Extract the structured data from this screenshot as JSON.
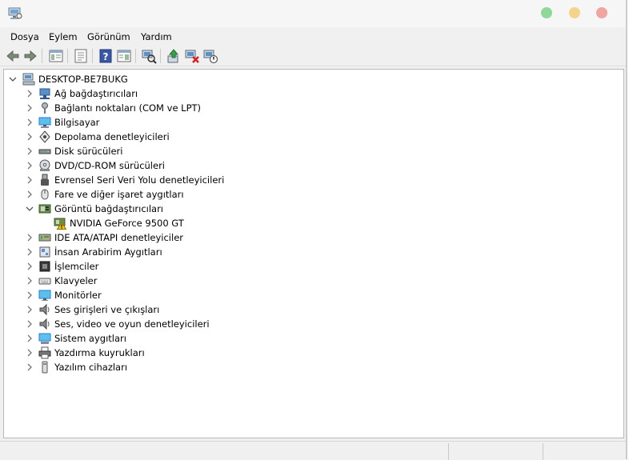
{
  "title": "",
  "menu": [
    "Dosya",
    "Eylem",
    "Görünüm",
    "Yardım"
  ],
  "toolbar": [
    "back-icon",
    "forward-icon",
    "show-hide-tree-icon",
    "properties-icon",
    "help-icon",
    "action-pane-icon",
    "scan-hardware-icon",
    "update-driver-icon",
    "uninstall-device-icon",
    "disable-device-icon"
  ],
  "tree": {
    "root": "DESKTOP-BE7BUKG",
    "items": [
      {
        "label": "Ağ bağdaştırıcıları",
        "icon": "network-adapter-icon",
        "expanded": false
      },
      {
        "label": "Bağlantı noktaları (COM ve LPT)",
        "icon": "port-icon",
        "expanded": false
      },
      {
        "label": "Bilgisayar",
        "icon": "computer-icon",
        "expanded": false
      },
      {
        "label": "Depolama denetleyicileri",
        "icon": "storage-controller-icon",
        "expanded": false
      },
      {
        "label": "Disk sürücüleri",
        "icon": "disk-drive-icon",
        "expanded": false
      },
      {
        "label": "DVD/CD-ROM sürücüleri",
        "icon": "dvd-drive-icon",
        "expanded": false
      },
      {
        "label": "Evrensel Seri Veri Yolu denetleyicileri",
        "icon": "usb-icon",
        "expanded": false
      },
      {
        "label": "Fare ve diğer işaret aygıtları",
        "icon": "mouse-icon",
        "expanded": false
      },
      {
        "label": "Görüntü bağdaştırıcıları",
        "icon": "display-adapter-icon",
        "expanded": true
      },
      {
        "label": "NVIDIA GeForce 9500 GT",
        "icon": "display-adapter-warning-icon",
        "child": true
      },
      {
        "label": "IDE ATA/ATAPI denetleyiciler",
        "icon": "ide-controller-icon",
        "expanded": false
      },
      {
        "label": "İnsan Arabirim Aygıtları",
        "icon": "hid-icon",
        "expanded": false
      },
      {
        "label": "İşlemciler",
        "icon": "processor-icon",
        "expanded": false
      },
      {
        "label": "Klavyeler",
        "icon": "keyboard-icon",
        "expanded": false
      },
      {
        "label": "Monitörler",
        "icon": "monitor-icon",
        "expanded": false
      },
      {
        "label": "Ses girişleri ve çıkışları",
        "icon": "audio-icon",
        "expanded": false
      },
      {
        "label": "Ses, video ve oyun denetleyicileri",
        "icon": "sound-video-icon",
        "expanded": false
      },
      {
        "label": "Sistem aygıtları",
        "icon": "system-device-icon",
        "expanded": false
      },
      {
        "label": "Yazdırma kuyrukları",
        "icon": "printer-icon",
        "expanded": false
      },
      {
        "label": "Yazılım cihazları",
        "icon": "software-device-icon",
        "expanded": false
      }
    ]
  },
  "colors": {
    "accent_blue": "#2a7bd3",
    "warning": "#f5c400"
  }
}
